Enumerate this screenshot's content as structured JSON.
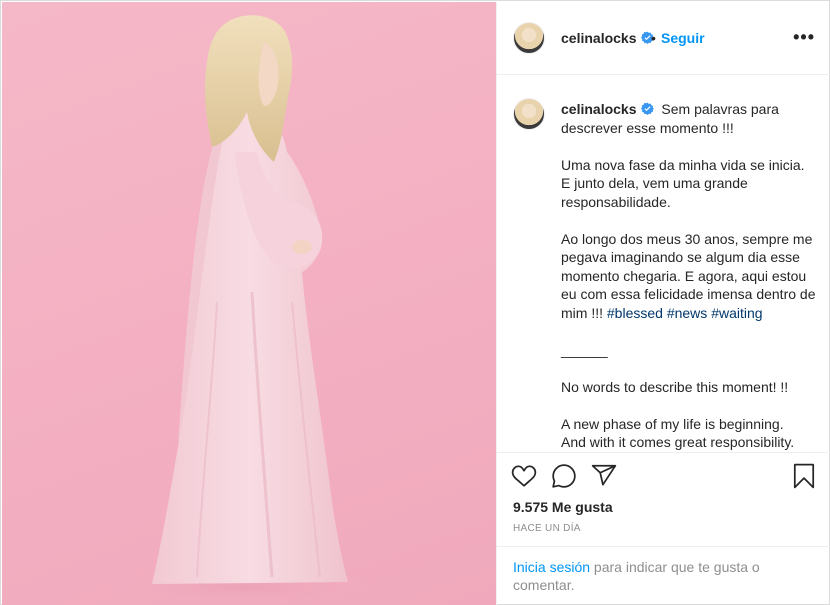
{
  "post": {
    "username": "celinalocks",
    "separator": "•",
    "follow_label": "Seguir",
    "more_label": "•••",
    "caption_first": "Sem palavras para descrever esse momento !!!",
    "caption_p2": "Uma nova fase da minha vida se inicia. E junto dela, vem uma grande responsabilidade.",
    "caption_p3": "Ao longo dos meus 30 anos, sempre me pegava imaginando se algum dia esse momento chegaria. E agora, aqui estou eu com essa felicidade imensa dentro de mim !!!",
    "hashtags": [
      "#blessed",
      "#news",
      "#waiting"
    ],
    "divider": "______",
    "caption_en1": "No words to describe this moment! !!",
    "caption_en2": "A new phase of my life is beginning.",
    "caption_en3": "And with it comes great responsibility.",
    "likes": "9.575 Me gusta",
    "timestamp": "HACE UN DÍA",
    "login_link": "Inicia sesión",
    "login_text": " para indicar que te gusta o comentar."
  },
  "colors": {
    "link_blue": "#0095f6",
    "hashtag": "#00376b",
    "verified": "#3897f0",
    "background_pink": "#f4b1c3",
    "dress": "#f7d6de"
  },
  "icons": [
    "verified-badge-icon",
    "heart-icon",
    "comment-icon",
    "share-icon",
    "bookmark-icon",
    "more-options-icon"
  ]
}
